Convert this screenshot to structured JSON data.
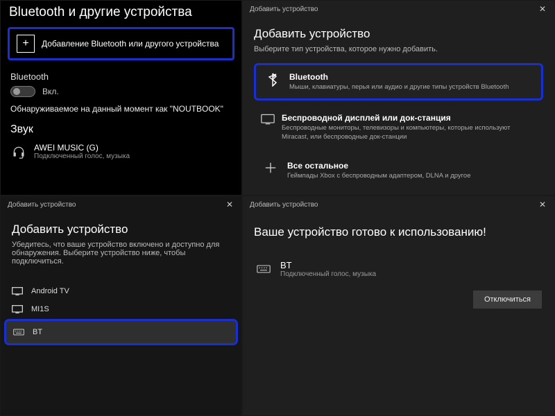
{
  "colors": {
    "highlight": "#1a2fcf"
  },
  "tl": {
    "title": "Bluetooth и другие устройства",
    "add_device": "Добавление Bluetooth или другого устройства",
    "bluetooth_label": "Bluetooth",
    "toggle_state": "Вкл.",
    "discoverable": "Обнаруживаемое на данный момент как \"NOUTBOOK\"",
    "sound_heading": "Звук",
    "device": {
      "name": "AWEI MUSIC (G)",
      "sub": "Подключенный голос, музыка"
    }
  },
  "tr": {
    "window_title": "Добавить устройство",
    "heading": "Добавить устройство",
    "sub": "Выберите тип устройства, которое нужно добавить.",
    "types": [
      {
        "title": "Bluetooth",
        "desc": "Мыши, клавиатуры, перья или аудио и другие типы устройств Bluetooth"
      },
      {
        "title": "Беспроводной дисплей или док-станция",
        "desc": "Беспроводные мониторы, телевизоры и компьютеры, которые используют Miracast, или беспроводные док-станции"
      },
      {
        "title": "Все остальное",
        "desc": "Геймпады Xbox с беспроводным адаптером, DLNA и другое"
      }
    ]
  },
  "bl": {
    "window_title": "Добавить устройство",
    "heading": "Добавить устройство",
    "sub": "Убедитесь, что ваше устройство включено и доступно для обнаружения. Выберите устройство ниже, чтобы подключиться.",
    "devices": [
      {
        "name": "Android TV"
      },
      {
        "name": "MI1S"
      },
      {
        "name": "BT"
      }
    ]
  },
  "br": {
    "window_title": "Добавить устройство",
    "heading": "Ваше устройство готово к использованию!",
    "device": {
      "name": "BT",
      "sub": "Подключенный голос, музыка"
    },
    "disconnect": "Отключиться"
  }
}
